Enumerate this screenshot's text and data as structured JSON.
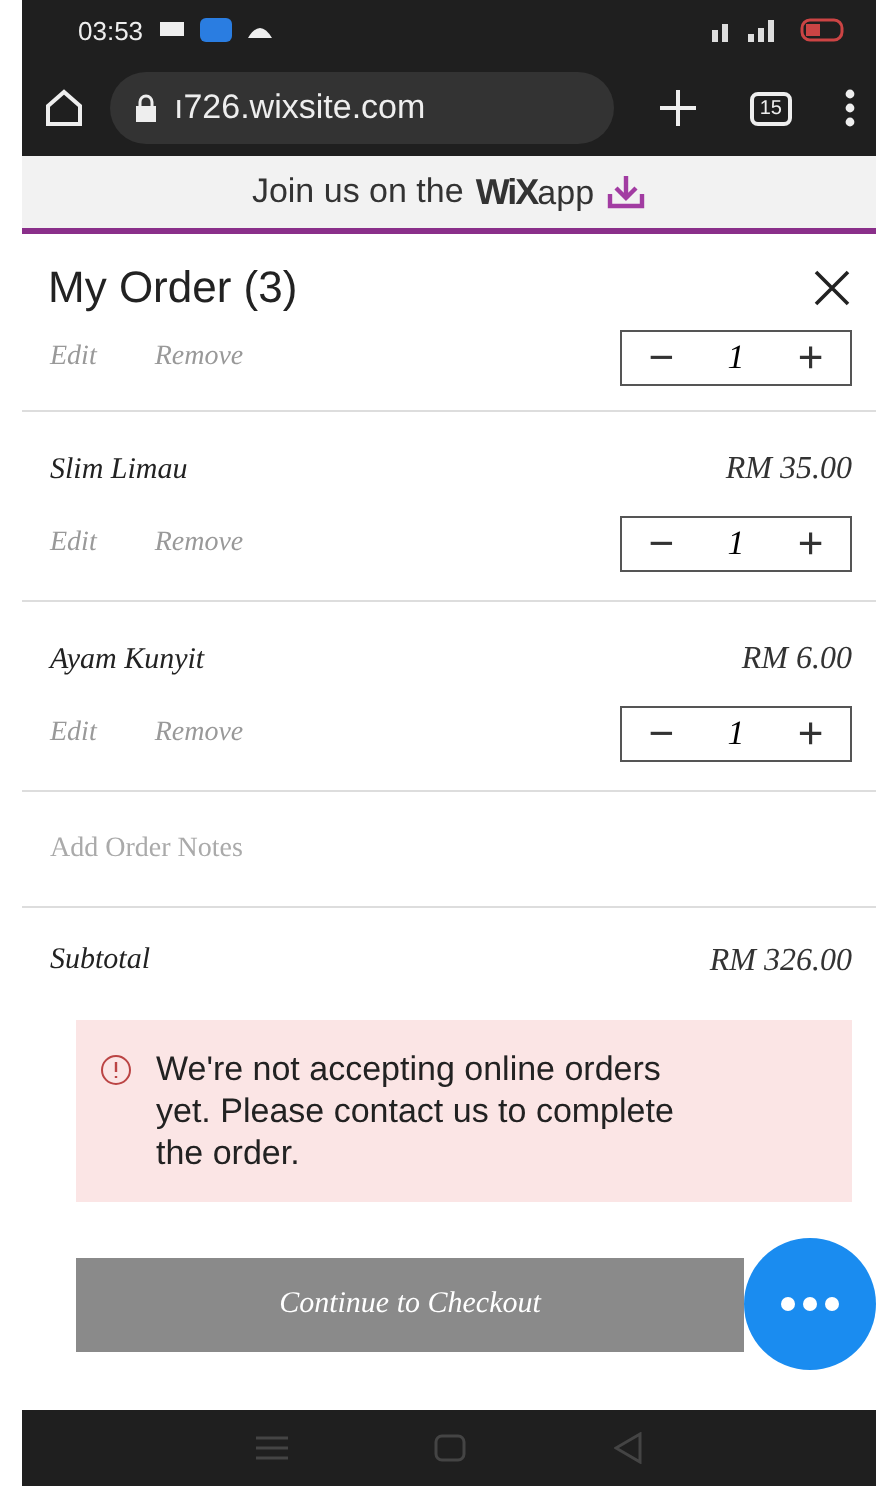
{
  "status_bar": {
    "time": "03:53"
  },
  "browser": {
    "url": "ı726.wixsite.com",
    "tab_count": "15"
  },
  "banner": {
    "text": "Join us on the",
    "brand": "WiX",
    "app": "app"
  },
  "cart": {
    "title": "My Order (3)",
    "items": [
      {
        "edit": "Edit",
        "remove": "Remove",
        "minus": "−",
        "quantity": "1",
        "plus": "+",
        "cut": true
      },
      {
        "name": "Slim Limau",
        "price": "RM 35.00",
        "edit": "Edit",
        "remove": "Remove",
        "minus": "−",
        "quantity": "1",
        "plus": "+",
        "cut": false
      },
      {
        "name": "Ayam Kunyit",
        "price": "RM 6.00",
        "edit": "Edit",
        "remove": "Remove",
        "minus": "−",
        "quantity": "1",
        "plus": "+",
        "cut": false
      }
    ],
    "notes_placeholder": "Add Order Notes",
    "subtotal_label": "Subtotal",
    "subtotal": "RM 326.00",
    "alert": "We're not accepting online orders yet. Please contact us to complete the order.",
    "checkout": {
      "label": "Continue to Checkout",
      "disabled": true
    }
  }
}
